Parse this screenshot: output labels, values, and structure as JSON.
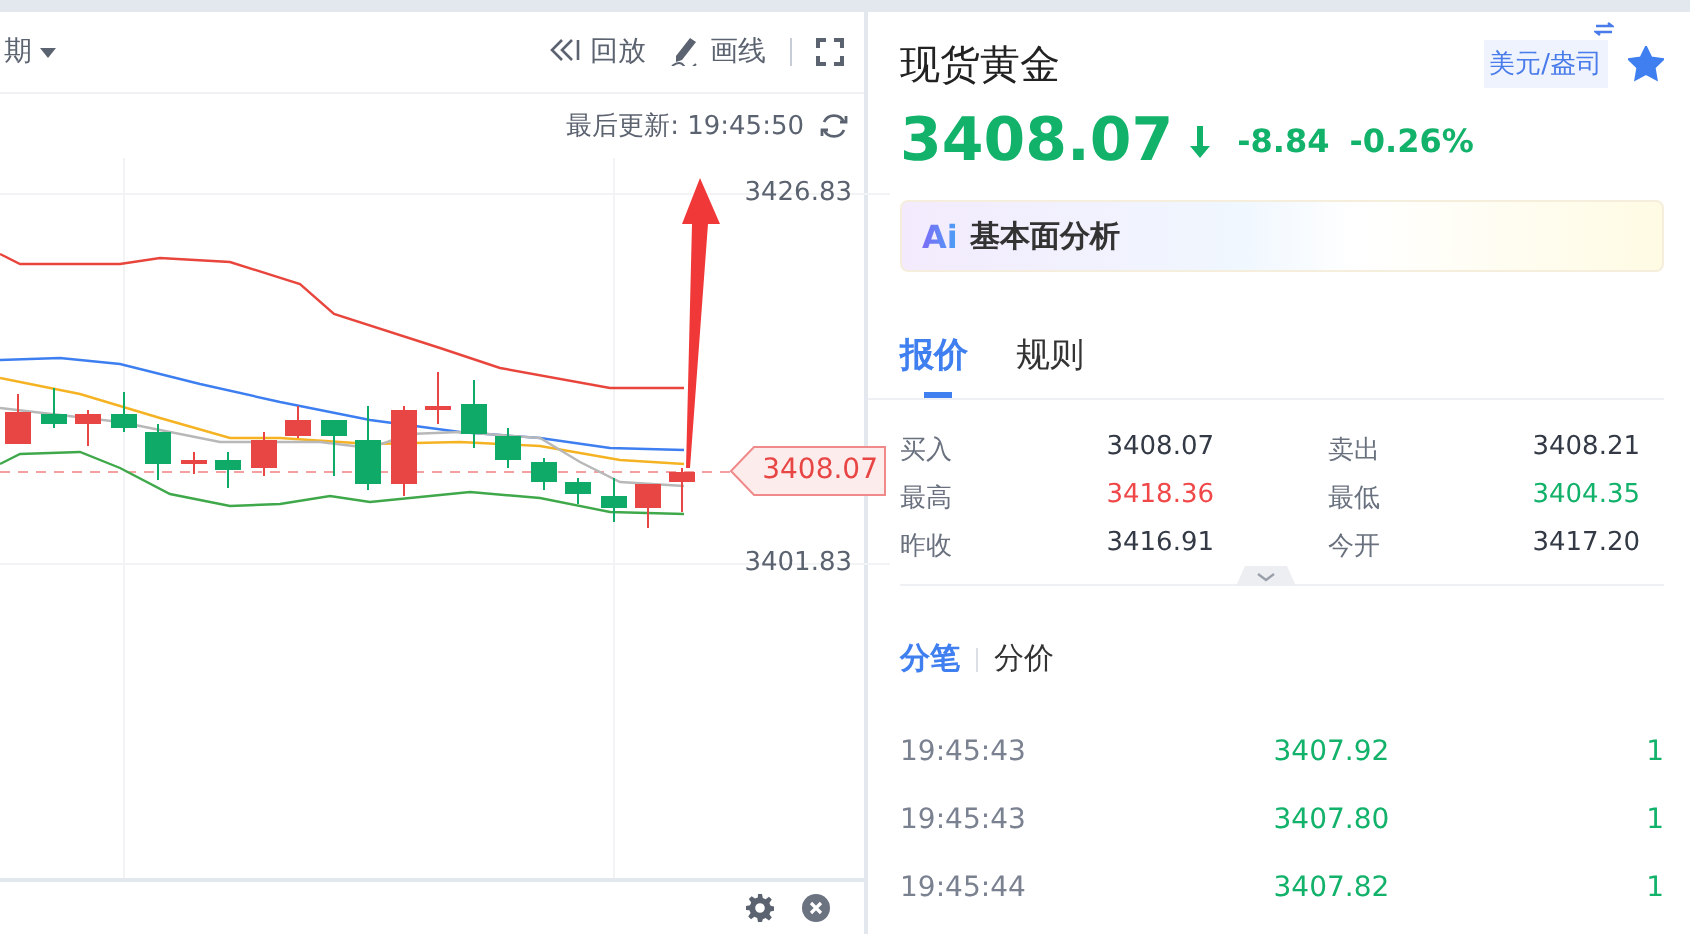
{
  "chart_toolbar": {
    "period": "期",
    "buttons": [
      {
        "kind": "replay",
        "label": "回放"
      },
      {
        "kind": "draw",
        "label": "画线"
      }
    ]
  },
  "last_update": "最后更新: 19:45:50",
  "price_axis": [
    "3426.83",
    "3401.83"
  ],
  "current_price_tag": "3408.07",
  "instrument": {
    "name": "现货黄金",
    "unit": "美元/盎司",
    "favorite": true,
    "falling": true,
    "price": "3408.07",
    "change": "-8.84",
    "change_percent": "-0.26%"
  },
  "ai_analysis": {
    "badge": "Ai",
    "label": "基本面分析"
  },
  "tabs": [
    {
      "label": "报价",
      "selected": true
    },
    {
      "label": "规则",
      "selected": false
    }
  ],
  "quotes": [
    {
      "label": "买入",
      "value": "3408.07",
      "color": "#333a45"
    },
    {
      "label": "卖出",
      "value": "3408.21",
      "color": "#333a45"
    },
    {
      "label": "最高",
      "value": "3418.36",
      "color": "#f04848"
    },
    {
      "label": "最低",
      "value": "3404.35",
      "color": "#13b26b"
    },
    {
      "label": "昨收",
      "value": "3416.91",
      "color": "#333a45"
    },
    {
      "label": "今开",
      "value": "3417.20",
      "color": "#333a45"
    }
  ],
  "trade_tabs": [
    {
      "label": "分笔",
      "selected": true
    },
    {
      "label": "分价",
      "selected": false
    }
  ],
  "trades": [
    {
      "time": "19:45:43",
      "price": "3407.92",
      "volume": "1"
    },
    {
      "time": "19:45:43",
      "price": "3407.80",
      "volume": "1"
    },
    {
      "time": "19:45:44",
      "price": "3407.82",
      "volume": "1"
    }
  ]
}
